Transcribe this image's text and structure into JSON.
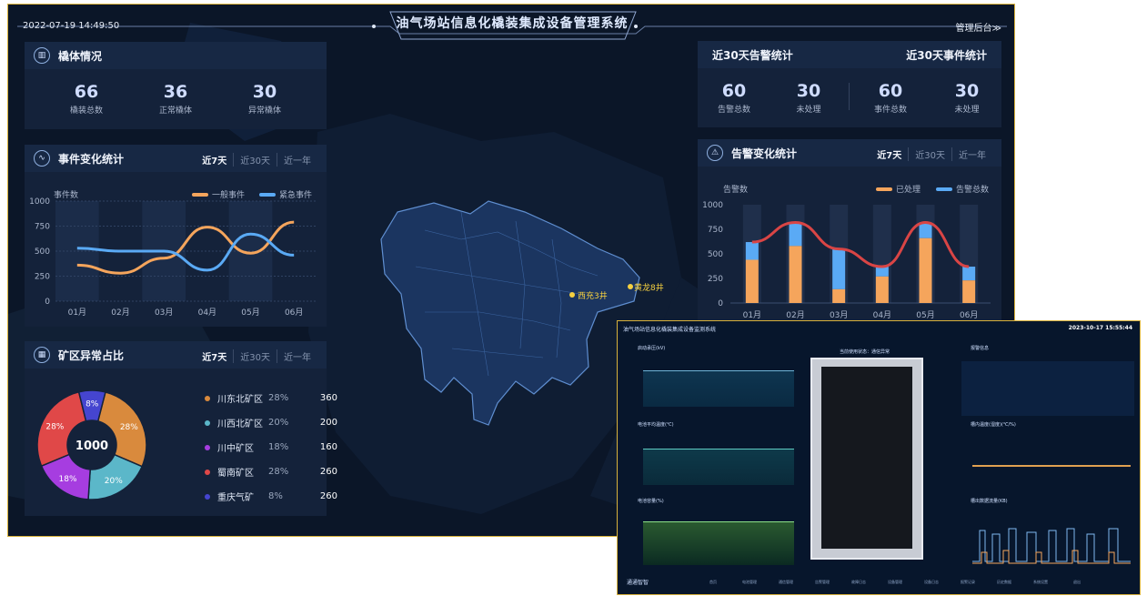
{
  "header": {
    "datetime": "2022-07-19  14:49:50",
    "title": "油气场站信息化橇装集成设备管理系统",
    "admin_link": "管理后台≫"
  },
  "skid": {
    "title": "橇体情况",
    "stats": [
      {
        "value": "66",
        "label": "橇装总数"
      },
      {
        "value": "36",
        "label": "正常橇体"
      },
      {
        "value": "30",
        "label": "异常橇体"
      }
    ]
  },
  "events": {
    "title": "事件变化统计",
    "tabs": [
      "近7天",
      "近30天",
      "近一年"
    ],
    "ylabel": "事件数",
    "legend": [
      {
        "name": "一般事件",
        "color": "#f5a55c"
      },
      {
        "name": "紧急事件",
        "color": "#5aaaf5"
      }
    ]
  },
  "mine": {
    "title": "矿区异常占比",
    "tabs": [
      "近7天",
      "近30天",
      "近一年"
    ],
    "total": "1000",
    "items": [
      {
        "name": "川东北矿区",
        "pct": "28%",
        "count": "360",
        "color": "#d98a3d"
      },
      {
        "name": "川西北矿区",
        "pct": "20%",
        "count": "200",
        "color": "#5bb7c9"
      },
      {
        "name": "川中矿区",
        "pct": "18%",
        "count": "160",
        "color": "#a63de0"
      },
      {
        "name": "蜀南矿区",
        "pct": "28%",
        "count": "260",
        "color": "#e04848"
      },
      {
        "name": "重庆气矿",
        "pct": "8%",
        "count": "260",
        "color": "#4545d0"
      }
    ],
    "slice_labels": [
      "28%",
      "20%",
      "18%",
      "28%",
      "8%"
    ]
  },
  "stats30": {
    "alarm_title": "近30天告警统计",
    "event_title": "近30天事件统计",
    "items": [
      {
        "value": "60",
        "label": "告警总数"
      },
      {
        "value": "30",
        "label": "未处理"
      },
      {
        "value": "60",
        "label": "事件总数"
      },
      {
        "value": "30",
        "label": "未处理"
      }
    ]
  },
  "alarm": {
    "title": "告警变化统计",
    "tabs": [
      "近7天",
      "近30天",
      "近一年"
    ],
    "ylabel": "告警数",
    "legend": [
      {
        "name": "已处理",
        "color": "#f5a55c"
      },
      {
        "name": "告警总数",
        "color": "#5aaaf5"
      }
    ]
  },
  "map": {
    "markers": [
      {
        "label": "西充3井"
      },
      {
        "label": "黄龙8井"
      }
    ]
  },
  "chart_data": [
    {
      "type": "line",
      "title": "事件变化统计",
      "ylabel": "事件数",
      "categories": [
        "01月",
        "02月",
        "03月",
        "04月",
        "05月",
        "06月"
      ],
      "ylim": [
        0,
        1000
      ],
      "yticks": [
        0,
        250,
        500,
        750,
        1000
      ],
      "series": [
        {
          "name": "一般事件",
          "values": [
            360,
            280,
            430,
            740,
            480,
            790
          ]
        },
        {
          "name": "紧急事件",
          "values": [
            530,
            500,
            500,
            310,
            670,
            460
          ]
        }
      ]
    },
    {
      "type": "bar",
      "title": "告警变化统计",
      "ylabel": "告警数",
      "categories": [
        "01月",
        "02月",
        "03月",
        "04月",
        "05月",
        "06月"
      ],
      "ylim": [
        0,
        1000
      ],
      "yticks": [
        0,
        250,
        500,
        750,
        1000
      ],
      "series": [
        {
          "name": "已处理",
          "values": [
            440,
            580,
            140,
            270,
            660,
            230
          ]
        },
        {
          "name": "告警总数",
          "values": [
            620,
            820,
            550,
            370,
            820,
            370
          ]
        }
      ]
    },
    {
      "type": "pie",
      "title": "矿区异常占比",
      "categories": [
        "川东北矿区",
        "川西北矿区",
        "川中矿区",
        "蜀南矿区",
        "重庆气矿"
      ],
      "values": [
        28,
        20,
        18,
        28,
        8
      ]
    }
  ],
  "inset": {
    "title": "油气场站信息化橇装集成设备监测系统",
    "datetime": "2023-10-17 15:55:44",
    "status": "当前使用状态：通信异常",
    "logo": "通通智智",
    "panels": [
      "启动承压(kV)",
      "电池平均温度(℃)",
      "电池容量(%)",
      "报警信息",
      "槽内温度(湿度)(℃/%)",
      "槽出数据流量(KB)"
    ],
    "nav": [
      "首页",
      "电池管理",
      "通信管理",
      "告警管理",
      "故障日志",
      "设备管理",
      "设备日志",
      "报警记录",
      "历史数据",
      "系统设置",
      "退出"
    ]
  }
}
